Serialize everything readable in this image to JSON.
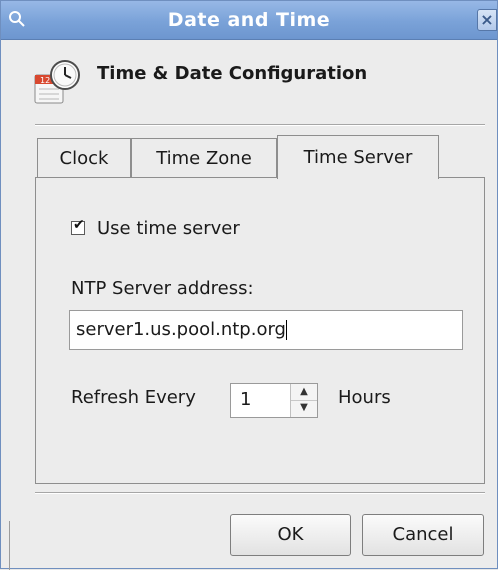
{
  "window": {
    "title": "Date and Time",
    "close_glyph": "×"
  },
  "header": {
    "title": "Time & Date Configuration",
    "icon": "calendar-clock-icon"
  },
  "tabs": [
    {
      "label": "Clock",
      "active": false
    },
    {
      "label": "Time Zone",
      "active": false
    },
    {
      "label": "Time Server",
      "active": true
    }
  ],
  "time_server": {
    "use_time_server_label": "Use time server",
    "use_time_server_checked": true,
    "ntp_label": "NTP Server address:",
    "ntp_value": "server1.us.pool.ntp.org",
    "refresh_label": "Refresh Every",
    "refresh_value": "1",
    "refresh_unit": "Hours"
  },
  "buttons": {
    "ok": "OK",
    "cancel": "Cancel"
  },
  "colors": {
    "titlebar": "#7aa2d8",
    "window_bg": "#ececec"
  }
}
